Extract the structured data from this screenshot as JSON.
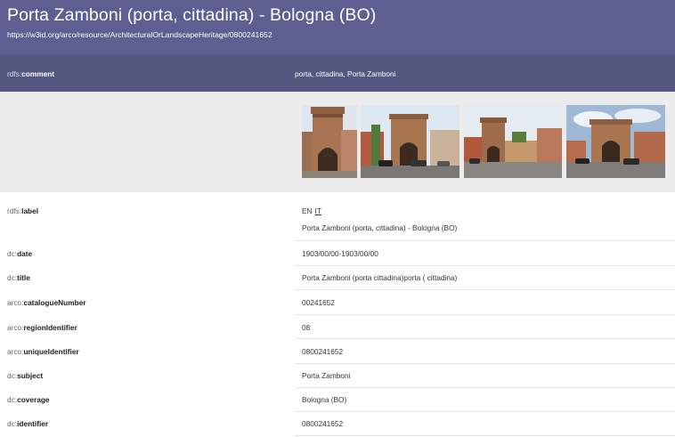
{
  "header": {
    "title": "Porta Zamboni (porta, cittadina) - Bologna (BO)",
    "uri": "https://w3id.org/arco/resource/ArchitecturalOrLandscapeHeritage/0800241652"
  },
  "comment": {
    "prefix": "rdfs:",
    "local": "comment",
    "value": "porta, cittadina, Porta Zamboni"
  },
  "gallery": {
    "images": [
      "Porta Zamboni photo 1",
      "Porta Zamboni photo 2",
      "Porta Zamboni photo 3",
      "Porta Zamboni photo 4"
    ]
  },
  "label": {
    "prefix": "rdfs:",
    "local": "label",
    "lang_active": "EN",
    "lang_other": "IT",
    "value": "Porta Zamboni (porta, cittadina) - Bologna (BO)"
  },
  "properties": [
    {
      "prefix": "dc:",
      "local": "date",
      "value": "1903/00/00-1903/00/00"
    },
    {
      "prefix": "dc:",
      "local": "title",
      "value": "Porta Zamboni (porta cittadina)porta ( cittadina)"
    },
    {
      "prefix": "arco:",
      "local": "catalogueNumber",
      "value": "00241652"
    },
    {
      "prefix": "arco:",
      "local": "regionIdentifier",
      "value": "08"
    },
    {
      "prefix": "arco:",
      "local": "uniqueIdentifier",
      "value": "0800241652"
    },
    {
      "prefix": "dc:",
      "local": "subject",
      "value": "Porta Zamboni"
    },
    {
      "prefix": "dc:",
      "local": "coverage",
      "value": "Bologna (BO)"
    },
    {
      "prefix": "dc:",
      "local": "identifier",
      "value": "0800241652"
    }
  ],
  "colors": {
    "header": "#5c5f8f",
    "comment_bar": "#54577f",
    "gallery_bg": "#ececec"
  }
}
